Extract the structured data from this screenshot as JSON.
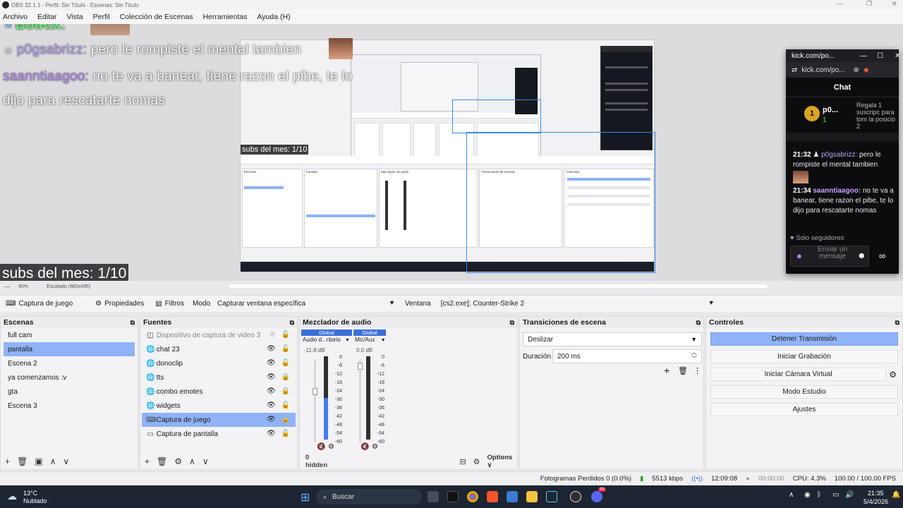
{
  "window": {
    "title": "OBS 32.1.1 - Perfil: Sin Título - Escenas: Sin Título"
  },
  "menu": {
    "items": [
      "Archivo",
      "Editar",
      "Vista",
      "Perfil",
      "Colección de Escenas",
      "Herramientas",
      "Ayuda (H)"
    ]
  },
  "preview": {
    "overlay_bot": "BotRix:",
    "overlay_chat": [
      {
        "user": "p0gsabrizz:",
        "text": " pero le rompiste el mental tambien"
      },
      {
        "user": "saanntiaagoo:",
        "text": " no te va a banear, tiene razon el pibe, te lo"
      },
      {
        "user": "",
        "text": "dijo para rescatarte nomas"
      }
    ],
    "subs_big": "subs del mes: 1/10",
    "subs_small": "subs del mes: 1/10",
    "zoom": "45%",
    "scaling": "Escalado (880x495)"
  },
  "kick": {
    "url_title": "kick.com/po...",
    "address": "kick.com/po...",
    "header": "Chat",
    "top_user": "p0...",
    "top_count": "1",
    "gift_text": "Regala 1 suscripc para tom la posició 2",
    "messages": [
      {
        "time": "21:32",
        "user": "p0gsabrizz:",
        "text": "pero le rompiste el mental tambien"
      },
      {
        "time": "21:34",
        "user": "saanntiaagoo:",
        "text": "no te va a banear, tiene razon el pibe, te lo dijo para rescatarte nomas"
      }
    ],
    "followers_only": "Solo seguidores",
    "input_placeholder": "Enviar un mensaje"
  },
  "source_toolbar": {
    "source_name": "Captura de juego",
    "properties": "Propiedades",
    "filters": "Filtros",
    "mode_label": "Modo",
    "mode_value": "Capturar ventana específica",
    "window_label": "Ventana",
    "window_value": "[cs2.exe]: Counter-Strike 2"
  },
  "scenes": {
    "title": "Escenas",
    "items": [
      "full cam",
      "pantalla",
      "Escena 2",
      "ya comenzamos :v",
      "gta",
      "Escena 3"
    ],
    "selected": "pantalla"
  },
  "sources": {
    "title": "Fuentes",
    "items": [
      {
        "name": "Dispositivo de captura de video 3",
        "icon": "camera-icon",
        "visible": false,
        "locked": false
      },
      {
        "name": "chat 23",
        "icon": "browser-icon",
        "visible": true,
        "locked": false
      },
      {
        "name": "donoclip",
        "icon": "browser-icon",
        "visible": true,
        "locked": false
      },
      {
        "name": "tts",
        "icon": "browser-icon",
        "visible": true,
        "locked": true
      },
      {
        "name": "combo emotes",
        "icon": "browser-icon",
        "visible": true,
        "locked": true
      },
      {
        "name": "widgets",
        "icon": "browser-icon",
        "visible": true,
        "locked": false
      },
      {
        "name": "Captura de juego",
        "icon": "gamepad-icon",
        "visible": true,
        "locked": true
      },
      {
        "name": "Captura de pantalla",
        "icon": "monitor-icon",
        "visible": true,
        "locked": false
      }
    ],
    "selected": "Captura de juego"
  },
  "mixer": {
    "title": "Mezclador de audio",
    "channels": [
      {
        "badge": "Global",
        "name": "Audio d...ritorio",
        "db": "-11.8 dB",
        "level": 0.5,
        "volume": 0.62
      },
      {
        "badge": "Global",
        "name": "Mic/Aux",
        "db": "0.0 dB",
        "level": 0.0,
        "volume": 0.95
      }
    ],
    "scale": [
      "0",
      "-6",
      "-12",
      "-18",
      "-24",
      "-30",
      "-36",
      "-42",
      "-48",
      "-54",
      "-60"
    ],
    "hidden": "0 hidden",
    "options": "Options"
  },
  "transitions": {
    "title": "Transiciones de escena",
    "type": "Deslizar",
    "duration_label": "Duración",
    "duration_value": "200 ms"
  },
  "controls": {
    "title": "Controles",
    "buttons": [
      "Detener Transmisión",
      "Iniciar Grabación",
      "Iniciar Cámara Virtual",
      "Modo Estudio",
      "Ajustes"
    ]
  },
  "status": {
    "dropped": "Fotogramas Perdidos 0 (0.0%)",
    "bitrate": "5513 kbps",
    "stream_time": "12:09:08",
    "rec_time": "00:00:00",
    "cpu": "CPU: 4.3%",
    "fps": "100.00 / 100.00 FPS"
  },
  "taskbar": {
    "temp": "13°C",
    "weather": "Nublado",
    "search": "Buscar",
    "time": "21:35",
    "date": "5/4/2026",
    "badge": "99"
  },
  "colors": {
    "accent": "#8fb3f6",
    "global_badge": "#3b6fd9",
    "kick_green": "#53fc18"
  }
}
